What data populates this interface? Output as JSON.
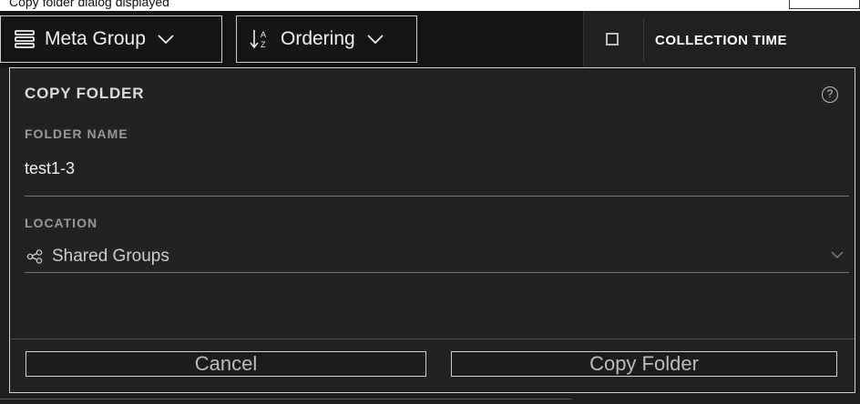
{
  "window": {
    "title": "Copy folder dialog displayed"
  },
  "toolbar": {
    "meta_group": {
      "label": "Meta Group",
      "icon": "stack-lines-icon",
      "chevron": "chevron-down-icon"
    },
    "ordering": {
      "label": "Ordering",
      "icon": "sort-az-icon",
      "chevron": "chevron-down-icon"
    }
  },
  "column_header": {
    "checkbox_checked": false,
    "label": "COLLECTION TIME"
  },
  "dialog": {
    "title": "COPY FOLDER",
    "help_icon": "question-circle-icon",
    "folder_name": {
      "label": "FOLDER NAME",
      "value": "test1-3"
    },
    "location": {
      "label": "LOCATION",
      "value": "Shared Groups",
      "icon": "share-nodes-icon"
    },
    "buttons": {
      "cancel": "Cancel",
      "copy": "Copy Folder"
    }
  },
  "colors": {
    "background": "#1e1e1e",
    "toolbar": "#151515",
    "dialog": "#222222",
    "border": "#d0d0d0"
  }
}
